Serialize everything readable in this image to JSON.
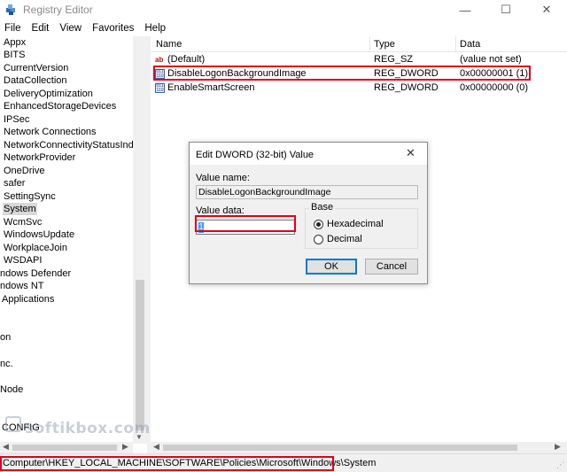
{
  "window": {
    "title": "Registry Editor",
    "min": "—",
    "max": "☐",
    "close": "✕"
  },
  "menu": [
    "File",
    "Edit",
    "View",
    "Favorites",
    "Help"
  ],
  "tree": {
    "items": [
      "Appx",
      "BITS",
      "CurrentVersion",
      "DataCollection",
      "DeliveryOptimization",
      "EnhancedStorageDevices",
      "IPSec",
      "Network Connections",
      "NetworkConnectivityStatusIndicato",
      "NetworkProvider",
      "OneDrive",
      "safer",
      "SettingSync",
      "System",
      "WcmSvc",
      "WindowsUpdate",
      "WorkplaceJoin",
      "WSDAPI",
      "ndows Defender",
      "ndows NT",
      "Applications"
    ],
    "selected_index": 13,
    "partial_items": [
      "on",
      "nc.",
      "Node",
      "CONFIG"
    ]
  },
  "list": {
    "columns": [
      "Name",
      "Type",
      "Data"
    ],
    "rows": [
      {
        "icon": "ab",
        "name": "(Default)",
        "type": "REG_SZ",
        "data": "(value not set)"
      },
      {
        "icon": "bin",
        "name": "DisableLogonBackgroundImage",
        "type": "REG_DWORD",
        "data": "0x00000001 (1)"
      },
      {
        "icon": "bin",
        "name": "EnableSmartScreen",
        "type": "REG_DWORD",
        "data": "0x00000000 (0)"
      }
    ]
  },
  "dialog": {
    "title": "Edit DWORD (32-bit) Value",
    "close": "✕",
    "value_name_label": "Value name:",
    "value_name": "DisableLogonBackgroundImage",
    "value_data_label": "Value data:",
    "value_data": "1",
    "base_label": "Base",
    "hex_label": "Hexadecimal",
    "dec_label": "Decimal",
    "base_selected": "Hexadecimal",
    "ok_label": "OK",
    "cancel_label": "Cancel"
  },
  "status": {
    "path": "Computer\\HKEY_LOCAL_MACHINE\\SOFTWARE\\Policies\\Microsoft\\Windows\\System"
  },
  "watermark": "softikbox.com",
  "colors": {
    "highlight": "#e0001a",
    "selection": "#3399ff",
    "accent": "#0078d7"
  }
}
